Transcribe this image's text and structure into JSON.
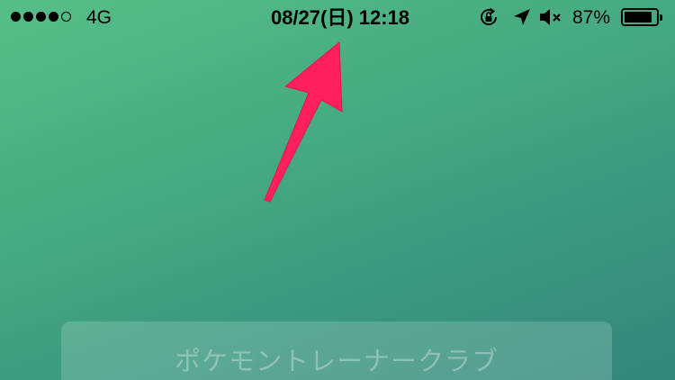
{
  "status_bar": {
    "signal_bars_total": 5,
    "signal_bars_filled": 4,
    "network": "4G",
    "datetime": "08/27(日) 12:18",
    "icons": [
      "orientation-lock-icon",
      "location-arrow-icon",
      "mute-icon"
    ],
    "battery_percent_label": "87%",
    "battery_level": 0.87
  },
  "annotation": {
    "icon": "arrow-icon",
    "color": "#ff1f5a"
  },
  "main": {
    "club_button_label": "ポケモントレーナークラブ"
  },
  "colors": {
    "background_start": "#57be88",
    "background_end": "#34877b",
    "status_text": "#000000"
  }
}
